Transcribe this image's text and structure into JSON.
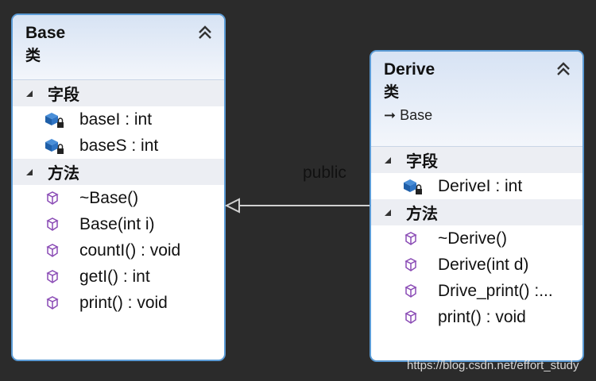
{
  "base": {
    "name": "Base",
    "stereotype": "类",
    "fields_label": "字段",
    "fields": [
      "baseI : int",
      "baseS : int"
    ],
    "methods_label": "方法",
    "methods": [
      "~Base()",
      "Base(int i)",
      "countI() : void",
      "getI() : int",
      "print() : void"
    ]
  },
  "derive": {
    "name": "Derive",
    "stereotype": "类",
    "parent": "Base",
    "fields_label": "字段",
    "fields": [
      "DeriveI : int"
    ],
    "methods_label": "方法",
    "methods": [
      "~Derive()",
      "Derive(int d)",
      "Drive_print() :...",
      "print() : void"
    ]
  },
  "relation": {
    "label": "public"
  },
  "watermark": "https://blog.csdn.net/effort_study",
  "colors": {
    "border": "#5b9bd5",
    "field_icon": "#2a6ebb",
    "method_icon": "#8a4bb5"
  }
}
